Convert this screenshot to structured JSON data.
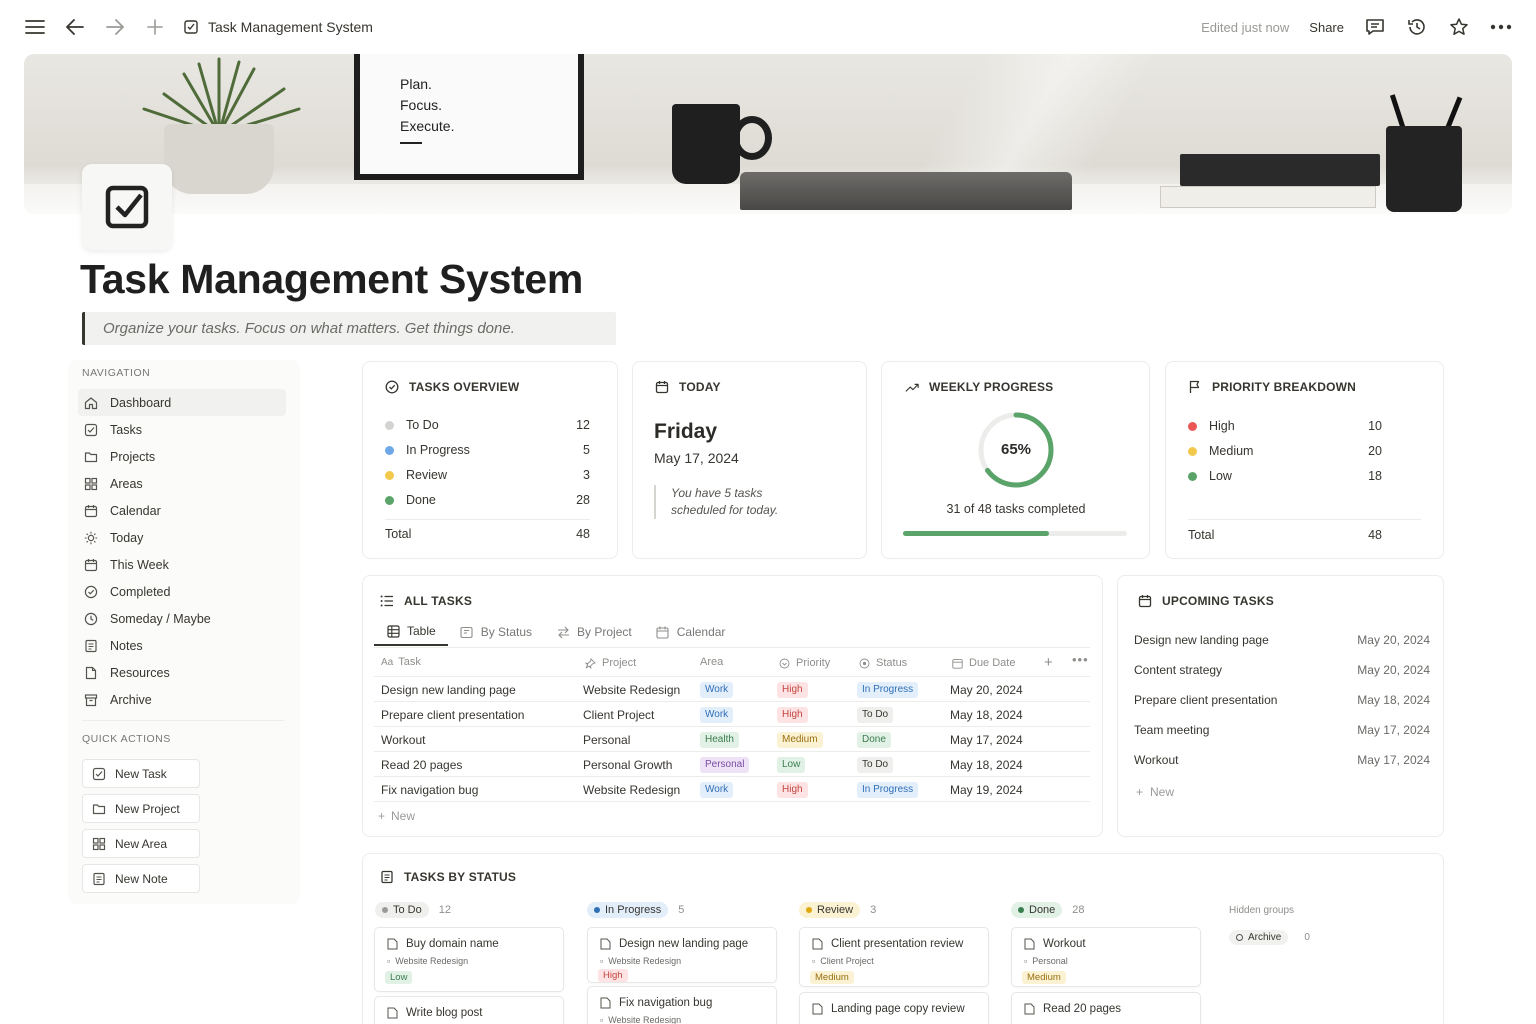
{
  "topbar": {
    "page_title": "Task Management System",
    "edited": "Edited just now",
    "share": "Share"
  },
  "cover": {
    "poster_lines": [
      "Plan.",
      "Focus.",
      "Execute."
    ]
  },
  "page": {
    "title": "Task Management System",
    "subtitle": "Organize your tasks. Focus on what matters. Get things done."
  },
  "sidebar": {
    "nav_label": "NAVIGATION",
    "items": [
      {
        "label": "Dashboard",
        "icon": "home-icon"
      },
      {
        "label": "Tasks",
        "icon": "checkbox-icon"
      },
      {
        "label": "Projects",
        "icon": "folder-icon"
      },
      {
        "label": "Areas",
        "icon": "grid-icon"
      },
      {
        "label": "Calendar",
        "icon": "calendar-icon"
      },
      {
        "label": "Today",
        "icon": "sun-icon"
      },
      {
        "label": "This Week",
        "icon": "calendar-icon"
      },
      {
        "label": "Completed",
        "icon": "check-circle-icon"
      },
      {
        "label": "Someday / Maybe",
        "icon": "clock-icon"
      },
      {
        "label": "Notes",
        "icon": "note-icon"
      },
      {
        "label": "Resources",
        "icon": "document-icon"
      },
      {
        "label": "Archive",
        "icon": "archive-icon"
      }
    ],
    "quick_label": "QUICK ACTIONS",
    "quick": [
      {
        "label": "New Task",
        "icon": "checkbox-icon"
      },
      {
        "label": "New Project",
        "icon": "folder-icon"
      },
      {
        "label": "New Area",
        "icon": "grid-icon"
      },
      {
        "label": "New Note",
        "icon": "note-icon"
      }
    ]
  },
  "overview": {
    "title": "TASKS OVERVIEW",
    "rows": [
      {
        "label": "To Do",
        "value": "12",
        "color": "#d3d3d1"
      },
      {
        "label": "In Progress",
        "value": "5",
        "color": "#6fa8e8"
      },
      {
        "label": "Review",
        "value": "3",
        "color": "#f2c94c"
      },
      {
        "label": "Done",
        "value": "28",
        "color": "#5aa469"
      }
    ],
    "total_label": "Total",
    "total_value": "48"
  },
  "today": {
    "title": "TODAY",
    "day": "Friday",
    "date": "May 17, 2024",
    "note": "You have 5 tasks scheduled for today."
  },
  "weekly": {
    "title": "WEEKLY PROGRESS",
    "percent_label": "65%",
    "percent": 0.65,
    "caption": "31 of 48 tasks completed",
    "accent": "#5aa469"
  },
  "priority": {
    "title": "PRIORITY BREAKDOWN",
    "rows": [
      {
        "label": "High",
        "value": "10",
        "color": "#eb5757"
      },
      {
        "label": "Medium",
        "value": "20",
        "color": "#f2c94c"
      },
      {
        "label": "Low",
        "value": "18",
        "color": "#5aa469"
      }
    ],
    "total_label": "Total",
    "total_value": "48"
  },
  "all_tasks": {
    "title": "ALL TASKS",
    "tabs": [
      "Table",
      "By Status",
      "By Project",
      "Calendar"
    ],
    "columns": [
      "Task",
      "Project",
      "Area",
      "Priority",
      "Status",
      "Due Date"
    ],
    "rows": [
      {
        "task": "Design new landing page",
        "project": "Website Redesign",
        "area": "Work",
        "priority": "High",
        "status": "In Progress",
        "due": "May 20, 2024"
      },
      {
        "task": "Prepare client presentation",
        "project": "Client Project",
        "area": "Work",
        "priority": "High",
        "status": "To Do",
        "due": "May 18, 2024"
      },
      {
        "task": "Workout",
        "project": "Personal",
        "area": "Health",
        "priority": "Medium",
        "status": "Done",
        "due": "May 17, 2024"
      },
      {
        "task": "Read 20 pages",
        "project": "Personal Growth",
        "area": "Personal",
        "priority": "Low",
        "status": "To Do",
        "due": "May 18, 2024"
      },
      {
        "task": "Fix navigation bug",
        "project": "Website Redesign",
        "area": "Work",
        "priority": "High",
        "status": "In Progress",
        "due": "May 19, 2024"
      }
    ],
    "new_label": "New"
  },
  "upcoming": {
    "title": "UPCOMING TASKS",
    "rows": [
      {
        "task": "Design new landing page",
        "date": "May 20, 2024"
      },
      {
        "task": "Content strategy",
        "date": "May 20, 2024"
      },
      {
        "task": "Prepare client presentation",
        "date": "May 18, 2024"
      },
      {
        "task": "Team meeting",
        "date": "May 17, 2024"
      },
      {
        "task": "Workout",
        "date": "May 17, 2024"
      }
    ],
    "new_label": "New"
  },
  "by_status": {
    "title": "TASKS BY STATUS",
    "columns": [
      {
        "label": "To Do",
        "count": "12"
      },
      {
        "label": "In Progress",
        "count": "5"
      },
      {
        "label": "Review",
        "count": "3"
      },
      {
        "label": "Done",
        "count": "28"
      }
    ],
    "hidden_label": "Hidden groups",
    "archive_label": "Archive",
    "archive_count": "0",
    "cards": [
      {
        "title": "Buy domain name",
        "sub": "Website Redesign",
        "pill": "Low"
      },
      {
        "title": "Write blog post",
        "sub": "",
        "pill": ""
      },
      {
        "title": "Design new landing page",
        "sub": "Website Redesign",
        "pill": "High"
      },
      {
        "title": "Fix navigation bug",
        "sub": "Website Redesign",
        "pill": ""
      },
      {
        "title": "Client presentation review",
        "sub": "Client Project",
        "pill": "Medium"
      },
      {
        "title": "Landing page copy review",
        "sub": "",
        "pill": ""
      },
      {
        "title": "Workout",
        "sub": "Personal",
        "pill": "Medium"
      },
      {
        "title": "Read 20 pages",
        "sub": "",
        "pill": ""
      }
    ]
  }
}
